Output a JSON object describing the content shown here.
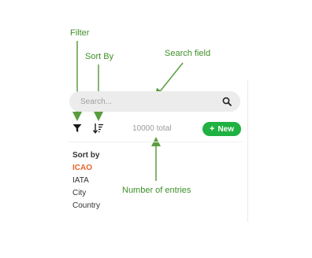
{
  "annotations": {
    "filter": "Filter",
    "sort_by": "Sort By",
    "search_field": "Search field",
    "number_of_entries": "Number of entries"
  },
  "search": {
    "placeholder": "Search..."
  },
  "toolbar": {
    "total": "10000 total",
    "new_label": "New"
  },
  "sort_menu": {
    "title": "Sort by",
    "options": [
      {
        "label": "ICAO",
        "active": true
      },
      {
        "label": "IATA",
        "active": false
      },
      {
        "label": "City",
        "active": false
      },
      {
        "label": "Country",
        "active": false
      }
    ]
  },
  "colors": {
    "accent_green": "#1fb141",
    "active_orange": "#e8632e",
    "annotation_green": "#3f8f2a"
  },
  "icons": [
    "search-icon",
    "filter-icon",
    "sort-icon",
    "plus-icon"
  ]
}
